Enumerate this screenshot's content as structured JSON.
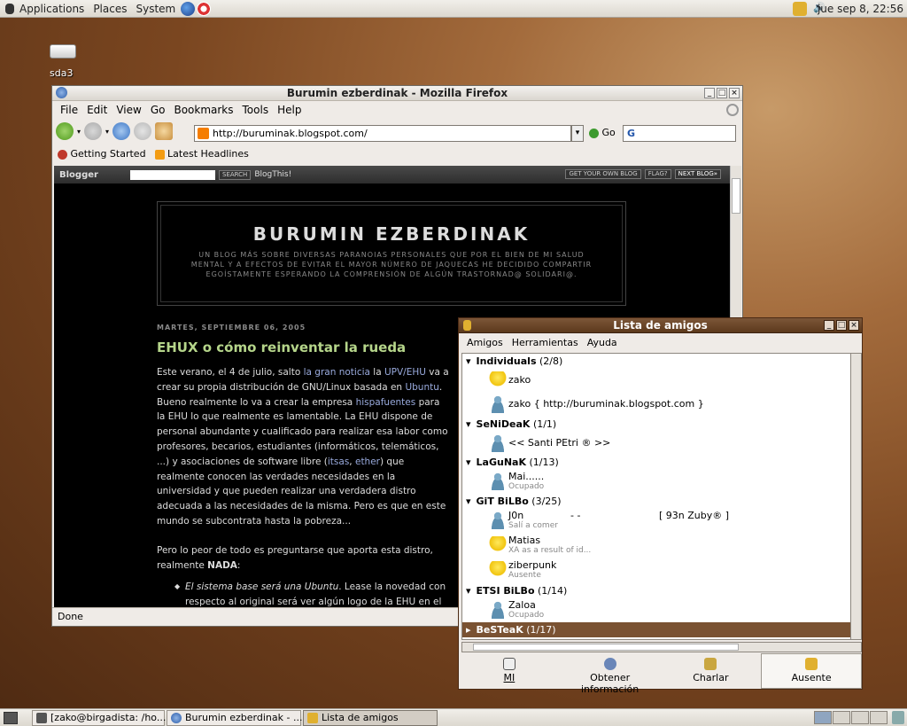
{
  "top_panel": {
    "menus": [
      "Applications",
      "Places",
      "System"
    ],
    "clock": "jue sep  8, 22:56"
  },
  "desktop": {
    "drive_label": "sda3"
  },
  "firefox": {
    "title": "Burumin ezberdinak - Mozilla Firefox",
    "menu": [
      "File",
      "Edit",
      "View",
      "Go",
      "Bookmarks",
      "Tools",
      "Help"
    ],
    "url": "http://buruminak.blogspot.com/",
    "go_label": "Go",
    "search_value": "G",
    "bookmarks": [
      "Getting Started",
      "Latest Headlines"
    ],
    "status": "Done"
  },
  "blogger": {
    "logo": "Blogger",
    "search_btn": "SEARCH",
    "blogthis": "BlogThis!",
    "get_own": "GET YOUR OWN BLOG",
    "flag": "FLAG?",
    "next": "NEXT BLOG»",
    "blog_title": "BURUMIN EZBERDINAK",
    "blog_desc": "UN BLOG MÁS SOBRE DIVERSAS PARANOIAS PERSONALES QUE POR EL BIEN DE MI SALUD MENTAL Y A EFECTOS DE EVITAR EL MAYOR NÚMERO DE JAQUECAS HE DECIDIDO COMPARTIR EGOÍSTAMENTE ESPERANDO LA COMPRENSIÓN DE ALGÚN TRASTORNAD@ SOLIDARI@.",
    "post_date": "MARTES, SEPTIEMBRE 06, 2005",
    "post_title": "EHUX o cómo reinventar la rueda",
    "p1_a": "Este verano, el 4 de julio, salto ",
    "p1_link1": "la gran noticia",
    "p1_b": " la ",
    "p1_link2": "UPV/EHU",
    "p1_c": " va a crear su propia distribución de GNU/Linux basada en ",
    "p1_link3": "Ubuntu",
    "p1_d": ". Bueno realmente lo va a crear la empresa ",
    "p1_link4": "hispafuentes",
    "p1_e": " para la EHU lo que realmente es lamentable. La EHU dispone de personal abundante y cualificado para realizar esa labor como profesores, becarios, estudiantes (informáticos, telemáticos, ...) y asociaciones de software libre (",
    "p1_link5": "itsas",
    "p1_f": ", ",
    "p1_link6": "ether",
    "p1_g": ") que realmente conocen las verdades necesidades en la universidad y que pueden realizar una verdadera distro adecuada a las necesidades de la misma. Pero es que en este mundo se subcontrata hasta la pobreza...",
    "p2_a": "Pero lo peor de todo es preguntarse que aporta esta distro, realmente ",
    "p2_b": "NADA",
    "p2_c": ":",
    "li_a": "El sistema base será una Ubuntu",
    "li_b": ". Lease la novedad con respecto al original será ver algún logo de la EHU en el"
  },
  "buddy_list": {
    "title": "Lista de amigos",
    "menu": [
      "Amigos",
      "Herramientas",
      "Ayuda"
    ],
    "groups": [
      {
        "name": "Individuals",
        "count": "(2/8)"
      },
      {
        "name": "SeNiDeaK",
        "count": "(1/1)"
      },
      {
        "name": "LaGuNaK",
        "count": "(1/13)"
      },
      {
        "name": "GiT BiLBo",
        "count": "(3/25)"
      },
      {
        "name": "ETSI BiLBo",
        "count": "(1/14)"
      },
      {
        "name": "BeSTeaK",
        "count": "(1/17)"
      }
    ],
    "buddies": {
      "zako1": {
        "name": "zako"
      },
      "zako2": {
        "name": "zako { http://buruminak.blogspot.com }"
      },
      "santi": {
        "name": "<< Santi PEtri ® >>"
      },
      "mai": {
        "name": "Mai......",
        "status": "Ocupado"
      },
      "jon": {
        "name": "J0n",
        "extra": "-  -",
        "extra2": "[  93n Zuby®  ]",
        "status": "Salí a comer"
      },
      "matias": {
        "name": "Matias",
        "status": "XA as a result of id..."
      },
      "ziberpunk": {
        "name": "ziberpunk",
        "status": "Ausente"
      },
      "zaloa": {
        "name": "Zaloa",
        "status": "Ocupado"
      }
    },
    "buttons": [
      "MI",
      "Obtener información",
      "Charlar",
      "Ausente"
    ]
  },
  "taskbar": {
    "tasks": [
      "[zako@birgadista: /ho...",
      "Burumin ezberdinak - ...",
      "Lista de amigos"
    ]
  },
  "colors": {
    "buddy_accent": "#7a5232",
    "blog_link": "#99aadd",
    "post_title": "#b5d58a"
  }
}
